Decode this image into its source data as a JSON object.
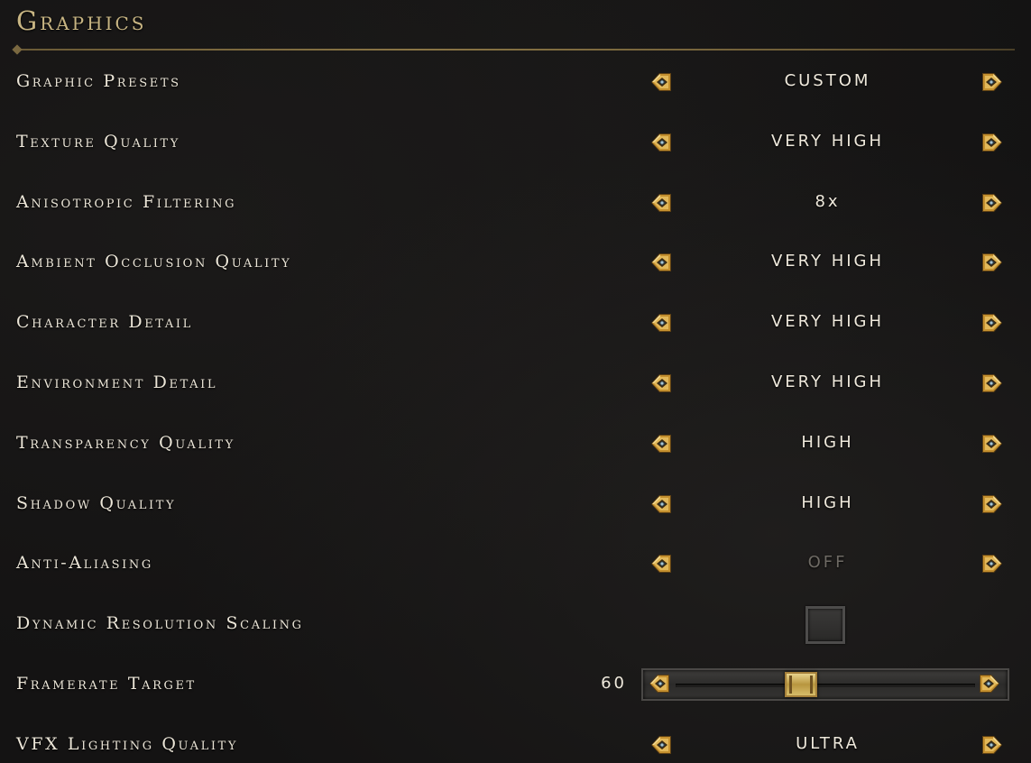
{
  "header": {
    "title": "Graphics"
  },
  "settings": [
    {
      "label": "Graphic Presets",
      "value": "CUSTOM",
      "kind": "selector"
    },
    {
      "label": "Texture Quality",
      "value": "VERY HIGH",
      "kind": "selector"
    },
    {
      "label": "Anisotropic Filtering",
      "value": "8x",
      "kind": "selector"
    },
    {
      "label": "Ambient Occlusion Quality",
      "value": "VERY HIGH",
      "kind": "selector"
    },
    {
      "label": "Character Detail",
      "value": "VERY HIGH",
      "kind": "selector"
    },
    {
      "label": "Environment Detail",
      "value": "VERY HIGH",
      "kind": "selector"
    },
    {
      "label": "Transparency Quality",
      "value": "HIGH",
      "kind": "selector"
    },
    {
      "label": "Shadow Quality",
      "value": "HIGH",
      "kind": "selector"
    },
    {
      "label": "Anti-Aliasing",
      "value": "OFF",
      "kind": "selector",
      "disabled": true
    },
    {
      "label": "Dynamic Resolution Scaling",
      "kind": "checkbox",
      "checked": false
    },
    {
      "label": "Framerate Target",
      "value": "60",
      "kind": "slider",
      "level": 0.41
    },
    {
      "label": "VFX Lighting Quality",
      "value": "ULTRA",
      "kind": "selector"
    }
  ],
  "icons": {
    "left_arrow": "gold-diamond-left-arrow-icon",
    "right_arrow": "gold-diamond-right-arrow-icon"
  },
  "colors": {
    "title": "#c8b583",
    "text": "#ece6d8",
    "disabled": "#6e6a64",
    "gold": "#c99a3a",
    "background": "#141313"
  }
}
